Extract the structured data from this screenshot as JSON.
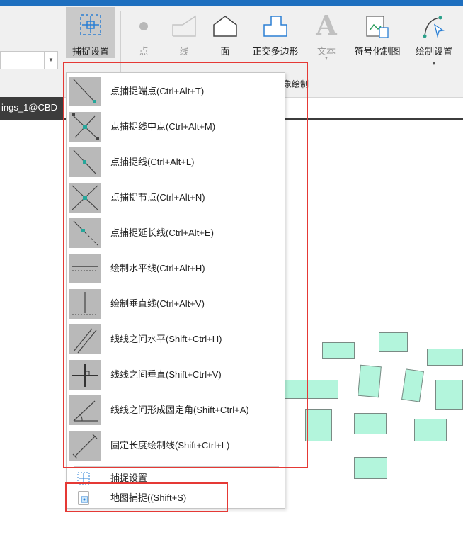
{
  "ribbon": {
    "snap_settings_label": "捕捉设置",
    "buttons": [
      {
        "label": "点",
        "icon": "point-icon",
        "enabled": false
      },
      {
        "label": "线",
        "icon": "line-icon",
        "enabled": false
      },
      {
        "label": "面",
        "icon": "polygon-icon",
        "enabled": true
      },
      {
        "label": "正交多边形",
        "icon": "orthogonal-polygon-icon",
        "enabled": true
      },
      {
        "label": "文本",
        "icon": "text-icon",
        "enabled": false
      },
      {
        "label": "符号化制图",
        "icon": "symbol-map-icon",
        "enabled": true
      },
      {
        "label": "绘制设置",
        "icon": "draw-settings-icon",
        "enabled": true
      }
    ],
    "group_label_partial": "象绘制"
  },
  "document_tab": {
    "title": "ings_1@CBD"
  },
  "snap_menu": {
    "items": [
      {
        "label": "点捕捉端点(Ctrl+Alt+T)",
        "icon": "snap-endpoint-icon"
      },
      {
        "label": "点捕捉线中点(Ctrl+Alt+M)",
        "icon": "snap-midpoint-icon"
      },
      {
        "label": "点捕捉线(Ctrl+Alt+L)",
        "icon": "snap-on-line-icon"
      },
      {
        "label": "点捕捉节点(Ctrl+Alt+N)",
        "icon": "snap-vertex-icon"
      },
      {
        "label": "点捕捉延长线(Ctrl+Alt+E)",
        "icon": "snap-extension-icon"
      },
      {
        "label": "绘制水平线(Ctrl+Alt+H)",
        "icon": "draw-horizontal-icon"
      },
      {
        "label": "绘制垂直线(Ctrl+Alt+V)",
        "icon": "draw-vertical-icon"
      },
      {
        "label": "线线之间水平(Shift+Ctrl+H)",
        "icon": "parallel-lines-icon"
      },
      {
        "label": "线线之间垂直(Shift+Ctrl+V)",
        "icon": "perpendicular-lines-icon"
      },
      {
        "label": "线线之间形成固定角(Shift+Ctrl+A)",
        "icon": "fixed-angle-icon"
      },
      {
        "label": "固定长度绘制线(Shift+Ctrl+L)",
        "icon": "fixed-length-icon"
      }
    ],
    "settings_label": "捕捉设置",
    "map_snap_label": "地图捕捉((Shift+S)"
  },
  "colors": {
    "highlight_box": "#e53935",
    "accent_teal": "#26a69a",
    "map_feature_fill": "#b3f5dc",
    "ribbon_tab_blue": "#1e6fbf"
  }
}
